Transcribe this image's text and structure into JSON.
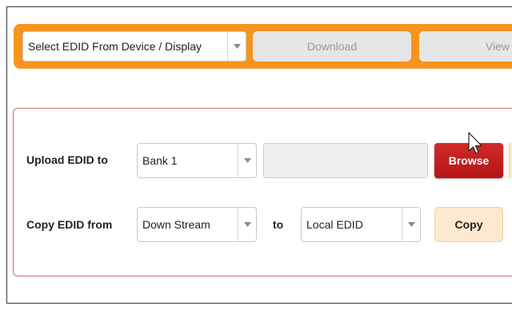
{
  "toolbar": {
    "source_select": {
      "value": "Select EDID From Device / Display"
    },
    "download_label": "Download",
    "view_label": "View / E"
  },
  "upload_row": {
    "label": "Upload EDID to",
    "bank_select": {
      "value": "Bank 1"
    },
    "file_field_value": "",
    "browse_label": "Browse"
  },
  "copy_row": {
    "label": "Copy EDID from",
    "from_select": {
      "value": "Down Stream"
    },
    "to_label": "to",
    "to_select": {
      "value": "Local EDID"
    },
    "copy_label": "Copy"
  },
  "colors": {
    "accent_orange": "#f7941d",
    "browse_red": "#c62020",
    "copy_cream": "#fde9cf",
    "panel_border": "#c77272"
  },
  "icons": {
    "dropdown": "chevron-down-icon",
    "cursor": "mouse-pointer-icon"
  }
}
